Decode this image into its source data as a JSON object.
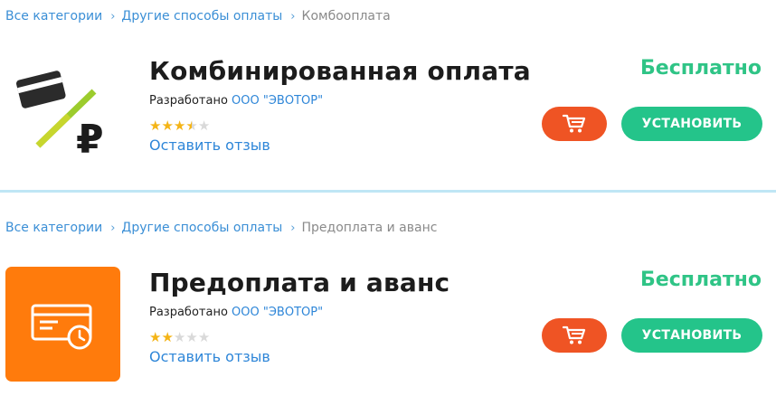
{
  "apps": [
    {
      "breadcrumb": [
        "Все категории",
        "Другие способы оплаты",
        "Комбооплата"
      ],
      "title": "Комбинированная оплата",
      "developer_prefix": "Разработано",
      "developer": "ООО \"ЭВОТОР\"",
      "rating": 3.5,
      "rating_max": 5,
      "review_link": "Оставить отзыв",
      "price": "Бесплатно",
      "install_label": "УСТАНОВИТЬ",
      "icon": "card-ruble-icon"
    },
    {
      "breadcrumb": [
        "Все категории",
        "Другие способы оплаты",
        "Предоплата и аванс"
      ],
      "title": "Предоплата и аванс",
      "developer_prefix": "Разработано",
      "developer": "ООО \"ЭВОТОР\"",
      "rating": 2,
      "rating_max": 5,
      "review_link": "Оставить отзыв",
      "price": "Бесплатно",
      "install_label": "УСТАНОВИТЬ",
      "icon": "card-clock-icon"
    }
  ],
  "colors": {
    "link": "#2e86d8",
    "price": "#2fc486",
    "cart_button": "#ef5424",
    "install_button": "#24c48a",
    "star_filled": "#f4b416",
    "star_empty": "#d9d9d9",
    "icon2_bg": "#ff7b0c"
  }
}
